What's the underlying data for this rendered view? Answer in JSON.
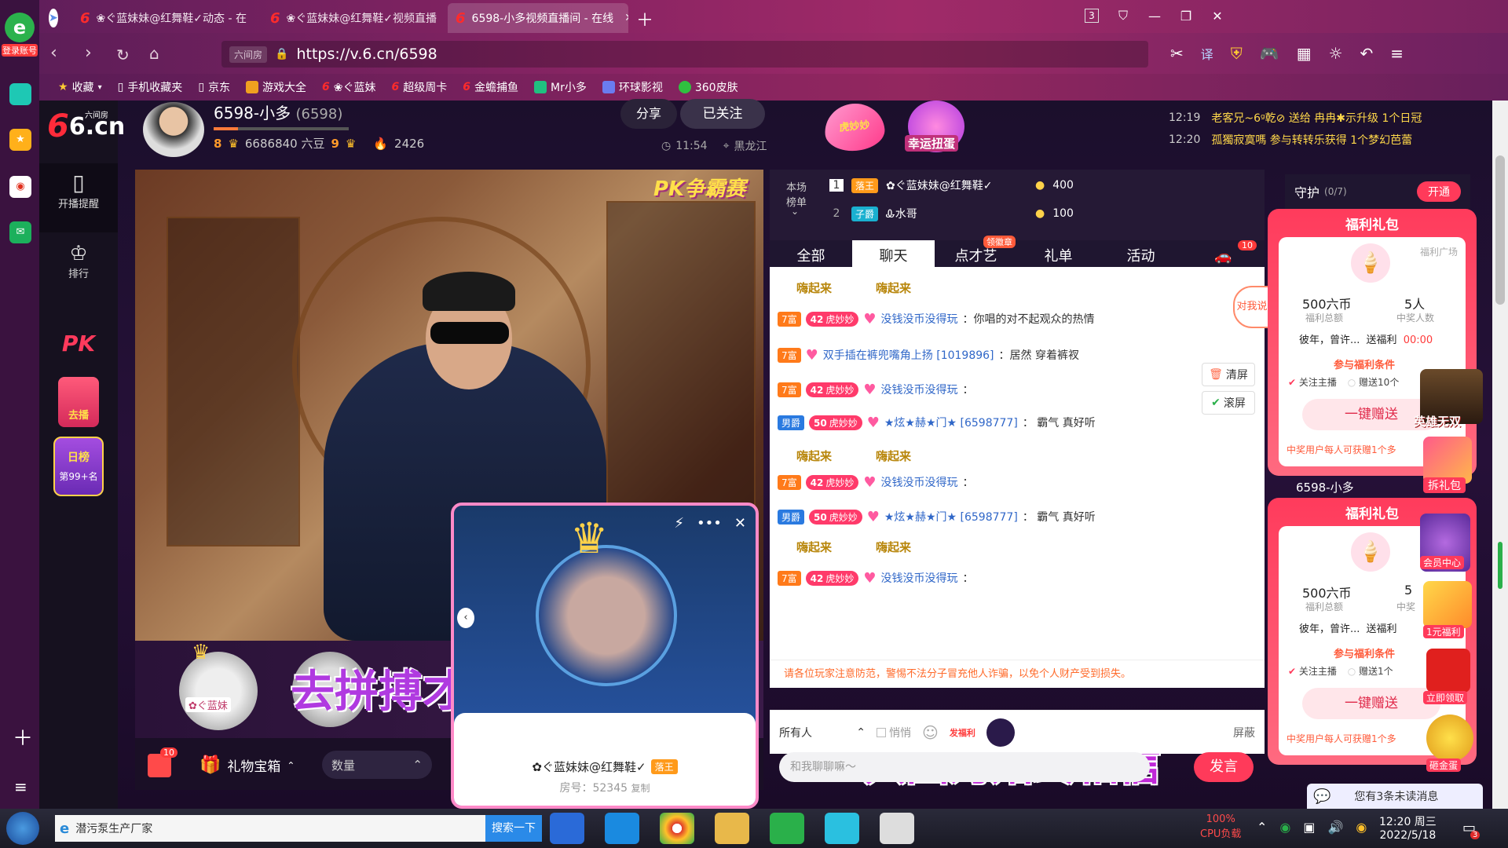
{
  "browser": {
    "tabs": [
      {
        "label": "❀ぐ蓝妹妹@红舞鞋✓动态 - 在"
      },
      {
        "label": "❀ぐ蓝妹妹@红舞鞋✓视频直播"
      },
      {
        "label": "6598-小多视频直播间 - 在线"
      }
    ],
    "tab_count": "3",
    "url_chip": "六间房",
    "url": "https://v.6.cn/6598",
    "translate": "译",
    "login_label": "登录账号"
  },
  "bookmarks": [
    {
      "label": "收藏"
    },
    {
      "label": "手机收藏夹"
    },
    {
      "label": "京东"
    },
    {
      "label": "游戏大全"
    },
    {
      "label": "❀ぐ蓝妹"
    },
    {
      "label": "超级周卡"
    },
    {
      "label": "金蟾捕鱼"
    },
    {
      "label": "Mr小多"
    },
    {
      "label": "环球影视"
    },
    {
      "label": "360皮肤"
    }
  ],
  "site": {
    "logo": "6.cn",
    "logo_small": "六间房",
    "nav": [
      {
        "label": "开播提醒"
      },
      {
        "label": "排行"
      }
    ],
    "pk": "PK",
    "rank_label": "日榜",
    "rank_value": "第99+名",
    "dangbo": "去播"
  },
  "host": {
    "name": "6598-小多",
    "room": "(6598)",
    "level_left": "8",
    "level_right": "9",
    "beans": "6686840 六豆",
    "fire": "2426",
    "share": "分享",
    "follow": "已关注",
    "time": "11:54",
    "location": "黑龙江"
  },
  "top_promo": {
    "hubao": "虎妙妙",
    "lucky": "幸运扭蛋"
  },
  "broadcast": [
    {
      "time": "12:19",
      "text": "老客兄~6ᵍ乾⊘ 送给 冉冉✱示升级 1个日冠"
    },
    {
      "time": "12:20",
      "text": "孤獨寂寞嗎 参与转转乐获得 1个梦幻芭蕾"
    }
  ],
  "rank": {
    "label": "本场榜单",
    "rows": [
      {
        "n": "1",
        "badge": "落王",
        "name": "✿ぐ蓝妹妹@红舞鞋✓",
        "score": "400"
      },
      {
        "n": "2",
        "badge": "子爵",
        "name": "Ꮂ水哥",
        "score": "100"
      }
    ]
  },
  "chat_tabs": [
    {
      "label": "全部"
    },
    {
      "label": "聊天"
    },
    {
      "label": "点才艺"
    },
    {
      "label": "礼单"
    },
    {
      "label": "活动"
    }
  ],
  "chat_tab_badge": "领徽章",
  "car_badge": "10",
  "chat": {
    "rows": [
      {
        "kind": "emote",
        "e1": "嗨起来",
        "e2": "嗨起来"
      },
      {
        "kind": "msg",
        "rank": "7富",
        "lv": "42",
        "pill": "虎妙妙",
        "name": "没钱没币没得玩",
        "text": "：你唱的对不起观众的热情"
      },
      {
        "kind": "msg",
        "rank": "7富",
        "lv": "",
        "pill": "",
        "name": "双手插在裤兜嘴角上扬 [1019896]",
        "text": "：居然 穿着裤衩"
      },
      {
        "kind": "msg",
        "rank": "7富",
        "lv": "42",
        "pill": "虎妙妙",
        "name": "没钱没币没得玩",
        "text": "："
      },
      {
        "kind": "msg",
        "rank": "男爵",
        "lv": "50",
        "pill": "虎妙妙",
        "name": "★炫★赫★门★ [6598777]",
        "text": "： 霸气  真好听"
      },
      {
        "kind": "emote",
        "e1": "嗨起来",
        "e2": "嗨起来"
      },
      {
        "kind": "msg",
        "rank": "7富",
        "lv": "42",
        "pill": "虎妙妙",
        "name": "没钱没币没得玩",
        "text": "："
      },
      {
        "kind": "msg",
        "rank": "男爵",
        "lv": "50",
        "pill": "虎妙妙",
        "name": "★炫★赫★门★ [6598777]",
        "text": "： 霸气  真好听"
      },
      {
        "kind": "emote",
        "e1": "嗨起来",
        "e2": "嗨起来"
      },
      {
        "kind": "msg",
        "rank": "7富",
        "lv": "42",
        "pill": "虎妙妙",
        "name": "没钱没币没得玩",
        "text": "："
      }
    ],
    "notice": "请各位玩家注意防范，警惕不法分子冒充他人诈骗，以免个人财产受到损失。",
    "clear": "清屏",
    "scroll": "滚屏",
    "to_me": "对我说",
    "recipient": "所有人",
    "whisper": "悄悄",
    "fafu": "发福利",
    "block": "屏蔽",
    "placeholder": "和我聊聊嘛～",
    "send": "发言"
  },
  "guard": {
    "label": "守护",
    "count": "(0/7)",
    "open": "开通"
  },
  "welfare": [
    {
      "title": "福利礼包",
      "square": "福利广场",
      "amount": "500六币",
      "amount_label": "福利总额",
      "people": "5人",
      "people_label": "中奖人数",
      "user": "彼年，曾许...",
      "action": "送福利",
      "timer": "00:00",
      "cond": "参与福利条件",
      "opt1": "关注主播",
      "opt2": "赠送10个",
      "gift": "一键赠送",
      "note": "中奖用户每人可获赠1个多"
    },
    {
      "title": "福利礼包",
      "square": "福利",
      "amount": "500六币",
      "amount_label": "福利总额",
      "people": "5",
      "people_label": "中奖",
      "user": "彼年，曾许...",
      "action": "送福利",
      "timer": "",
      "cond": "参与福利条件",
      "opt1": "关注主播",
      "opt2": "赠送1个",
      "gift": "一键赠送",
      "note": "中奖用户每人可获赠1个多"
    }
  ],
  "side_promos": [
    {
      "label": "英雄无双"
    },
    {
      "label": "拆礼包"
    },
    {
      "label": "会员中心"
    },
    {
      "label": "1元福利"
    },
    {
      "label": "立即领取"
    },
    {
      "label": "砸金蛋"
    }
  ],
  "mid_label": "6598-小多",
  "video": {
    "pk_label": "PK争霸赛",
    "seat1": "✿ぐ蓝妹",
    "overlay": "去拼搏才能胜利"
  },
  "popup": {
    "name": "✿ぐ蓝妹妹@红舞鞋✓",
    "badge": "落王",
    "room": "房号：52345",
    "copy": "复制"
  },
  "bottom": {
    "gift_box": "礼物宝箱",
    "qty": "数量",
    "gift_count": "10"
  },
  "lyric": "只因为始终相信",
  "unread": "您有3条未读消息",
  "taskbar": {
    "search_item": "潜污泵生产厂家",
    "search_btn": "搜索一下",
    "cpu": "100%",
    "cpu_label": "CPU负载",
    "time": "12:20 周三",
    "date": "2022/5/18",
    "msg_count": "3"
  }
}
